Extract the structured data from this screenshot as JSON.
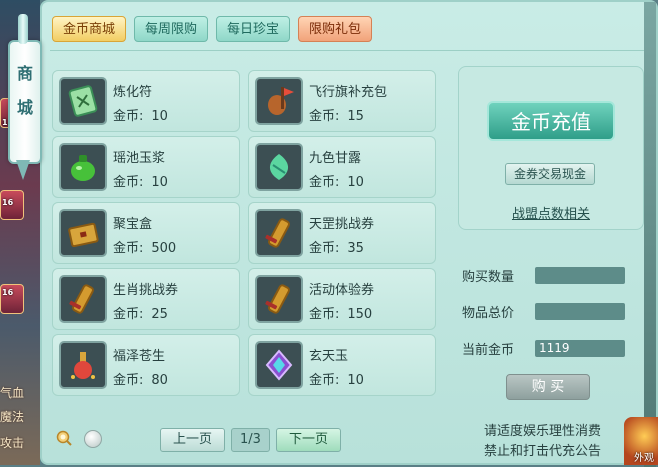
{
  "vertical_tab": {
    "chars": [
      "商",
      "城"
    ]
  },
  "left_strip": {
    "badges": [
      "1",
      "16",
      "16"
    ],
    "words": [
      "气血",
      "魔法",
      "攻击"
    ]
  },
  "tabs": [
    {
      "label": "金币商城",
      "style": "gold",
      "active": true
    },
    {
      "label": "每周限购",
      "style": "teal",
      "active": false
    },
    {
      "label": "每日珍宝",
      "style": "teal",
      "active": false
    },
    {
      "label": "限购礼包",
      "style": "orange",
      "active": false
    }
  ],
  "price_label": "金币:",
  "items": [
    {
      "name": "炼化符",
      "price": "10",
      "icon": "talisman-icon",
      "color": "#9be0a5"
    },
    {
      "name": "飞行旗补充包",
      "price": "15",
      "icon": "flag-bag-icon",
      "color": "#b7652c"
    },
    {
      "name": "瑶池玉浆",
      "price": "10",
      "icon": "jade-pot-icon",
      "color": "#47c13a"
    },
    {
      "name": "九色甘露",
      "price": "10",
      "icon": "dew-gem-icon",
      "color": "#5bd6a0"
    },
    {
      "name": "聚宝盒",
      "price": "500",
      "icon": "treasure-box-icon",
      "color": "#d8a53c"
    },
    {
      "name": "天罡挑战券",
      "price": "35",
      "icon": "scroll-icon",
      "color": "#d49b2f"
    },
    {
      "name": "生肖挑战券",
      "price": "25",
      "icon": "scroll-icon",
      "color": "#d49b2f"
    },
    {
      "name": "活动体验券",
      "price": "150",
      "icon": "scroll-icon",
      "color": "#d49b2f"
    },
    {
      "name": "福泽苍生",
      "price": "80",
      "icon": "potion-icon",
      "color": "#e0473c"
    },
    {
      "name": "玄天玉",
      "price": "10",
      "icon": "purple-gem-icon",
      "color": "#8a4fd1"
    }
  ],
  "pager": {
    "prev": "上一页",
    "page": "1/3",
    "next": "下一页"
  },
  "right": {
    "recharge": "金币充值",
    "voucher": "金券交易现金",
    "alliance": "战盟点数相关",
    "qty_label": "购买数量",
    "qty_value": "",
    "total_label": "物品总价",
    "total_value": "",
    "gold_label": "当前金币",
    "gold_value": "1119",
    "buy": "购 买"
  },
  "notice": [
    "请适度娱乐理性消费",
    "禁止和打击代充公告"
  ],
  "corner_label": "外观"
}
